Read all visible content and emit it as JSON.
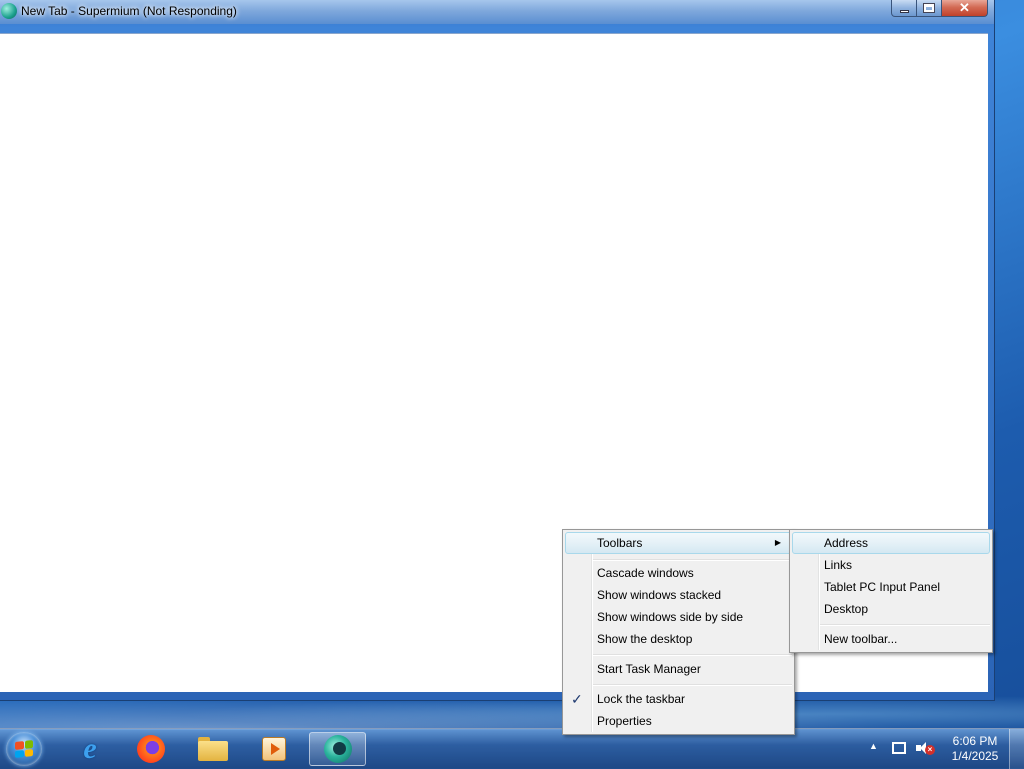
{
  "window": {
    "title": "New Tab - Supermium (Not Responding)",
    "minimize_label": "",
    "maximize_label": "",
    "close_label": "✕"
  },
  "context_menu": {
    "items": [
      {
        "label": "Toolbars",
        "has_submenu": true,
        "highlighted": true
      },
      {
        "label": "Cascade windows"
      },
      {
        "label": "Show windows stacked"
      },
      {
        "label": "Show windows side by side"
      },
      {
        "label": "Show the desktop"
      },
      {
        "label": "Start Task Manager"
      },
      {
        "label": "Lock the taskbar",
        "checked": true
      },
      {
        "label": "Properties"
      }
    ],
    "submenu_arrow": "▶",
    "check_mark": "✓"
  },
  "toolbars_submenu": {
    "items": [
      {
        "label": "Address",
        "highlighted": true
      },
      {
        "label": "Links"
      },
      {
        "label": "Tablet PC Input Panel"
      },
      {
        "label": "Desktop"
      },
      {
        "label": "New toolbar..."
      }
    ]
  },
  "taskbar": {
    "pinned": [
      {
        "icon": "internet-explorer-icon",
        "glyph": "e"
      },
      {
        "icon": "firefox-icon"
      },
      {
        "icon": "file-explorer-icon"
      },
      {
        "icon": "media-player-icon"
      },
      {
        "icon": "supermium-icon",
        "active": true
      }
    ],
    "tray": {
      "expand_arrow": "▲",
      "volume_muted_mark": "×",
      "time": "6:06 PM",
      "date": "1/4/2025"
    }
  },
  "colors": {
    "menu_bg": "#f0f0f0",
    "menu_highlight_border": "#a8d8eb",
    "taskbar_blue": "#2b5c9e"
  }
}
